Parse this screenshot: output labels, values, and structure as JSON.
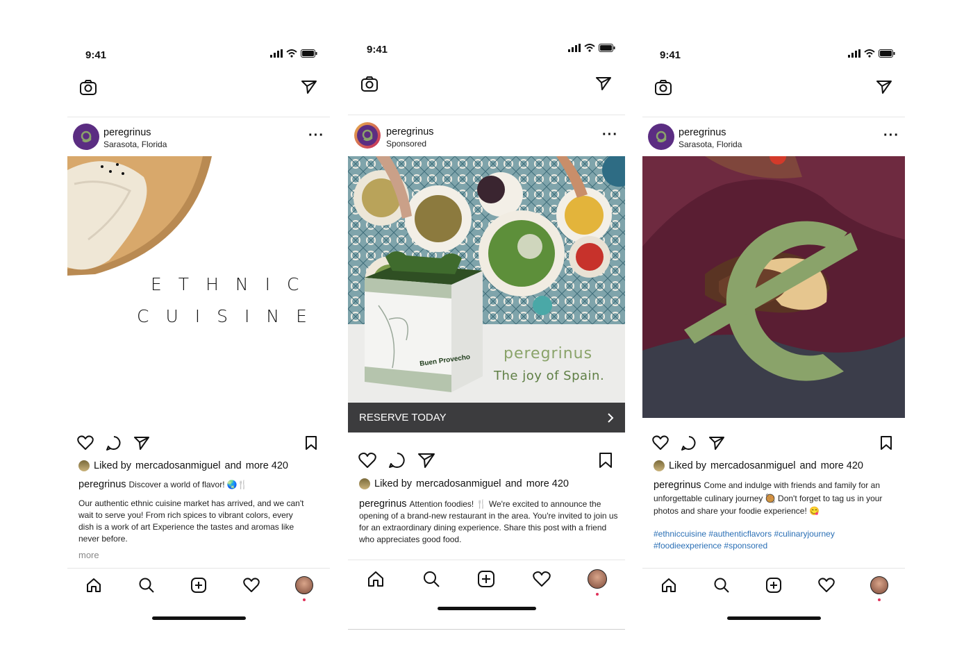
{
  "status_time": "9:41",
  "colors": {
    "brand_purple": "#5b2d82",
    "brand_green": "#8aa36a",
    "cta_bar": "#3c3c3e",
    "hashtag": "#2a6fb5",
    "notif_dot": "#e0325a"
  },
  "icons": {
    "camera": "camera-icon",
    "send": "send-icon",
    "heart": "heart-icon",
    "comment": "comment-icon",
    "share": "share-icon",
    "bookmark": "bookmark-icon",
    "home": "home-icon",
    "search": "search-icon",
    "add": "add-post-icon",
    "more": "more-options-icon"
  },
  "posts": [
    {
      "username": "peregrinus",
      "subtitle": "Sarasota, Florida",
      "image_text": [
        "ETHNIC",
        "CUISINE"
      ],
      "liked_prefix": "Liked by",
      "liked_user": "mercadosanmiguel",
      "liked_and": "and",
      "liked_more": "more 420",
      "caption_user": "peregrinus",
      "caption_head": "Discover a world of flavor! 🌏🍴",
      "caption_body": "Our authentic ethnic cuisine market has arrived, and we can't wait to serve you! From rich spices to vibrant colors, every dish is a work of art  Experience the tastes and aromas like never before.",
      "more_label": "more"
    },
    {
      "username": "peregrinus",
      "subtitle": "Sponsored",
      "box_label": "Buen Provecho",
      "brand_name": "peregrinus",
      "tagline": "The joy of Spain.",
      "cta_label": "RESERVE TODAY",
      "liked_prefix": "Liked by",
      "liked_user": "mercadosanmiguel",
      "liked_and": "and",
      "liked_more": "more 420",
      "caption_user": "peregrinus",
      "caption_body": "Attention foodies! 🍴 We're excited to announce the opening of a brand-new restaurant in the area. You're invited to join us for an extraordinary dining experience. Share this post with a friend who appreciates good food."
    },
    {
      "username": "peregrinus",
      "subtitle": "Sarasota, Florida",
      "liked_prefix": "Liked by",
      "liked_user": "mercadosanmiguel",
      "liked_and": "and",
      "liked_more": "more 420",
      "caption_user": "peregrinus",
      "caption_body": "Come and indulge with friends and family for an unforgettable culinary journey 🥘 Don't forget to tag us in your photos and share your foodie experience! 😋",
      "hashtags": "#ethniccuisine #authenticflavors #culinaryjourney #foodieexperience #sponsored"
    }
  ]
}
